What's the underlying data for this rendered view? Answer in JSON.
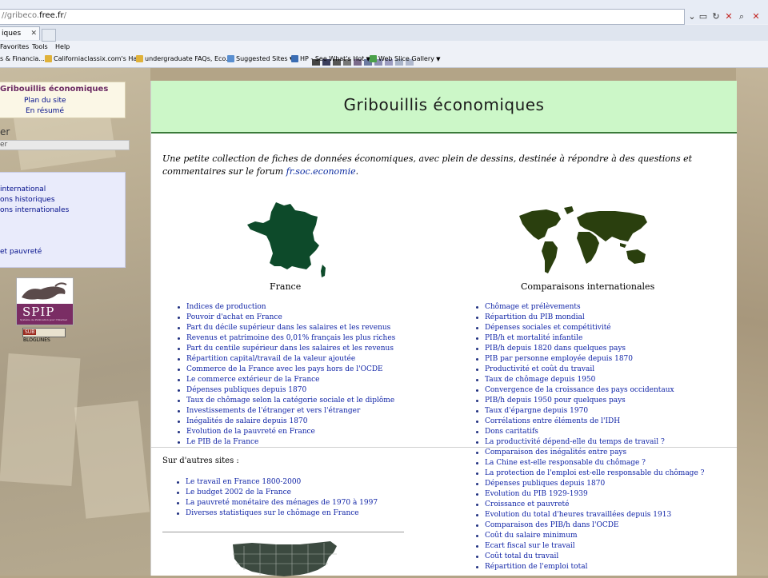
{
  "browser": {
    "url_prefix": "//gribeco.",
    "url_host": "free.fr",
    "url_suffix": "/",
    "tab_label": "iques",
    "menu": [
      "Favorites",
      "Tools",
      "Help"
    ],
    "favorites": [
      {
        "label": "s & Financia...",
        "icon_color": "#d9822b"
      },
      {
        "label": "Californiaclassix.com's Ha...",
        "icon_color": "#e0b23a"
      },
      {
        "label": "undergraduate FAQs, Eco...",
        "icon_color": "#e0b23a"
      },
      {
        "label": "Suggested Sites",
        "icon_color": "#5a8fd0",
        "dropdown": true
      },
      {
        "label": "HP - See What's Hot",
        "icon_color": "#3b6db3",
        "dropdown": true
      },
      {
        "label": "Web Slice Gallery",
        "icon_color": "#4aa04a",
        "dropdown": true
      }
    ],
    "swatch_colors": [
      "#444",
      "#3a3d5c",
      "#555",
      "#777",
      "#7a6a8a",
      "#6c7aa0",
      "#8d8fb3",
      "#9c9cc0",
      "#a9b4c9",
      "#b0b9ce"
    ]
  },
  "sidebar": {
    "site_title": "Gribouillis économiques",
    "plan_label": "Plan du site",
    "resume_label": "En résumé",
    "search_title": "er",
    "search_value": "er",
    "rubriques": [
      "international",
      "ons historiques",
      "ons internationales",
      "",
      "et pauvreté"
    ],
    "spip_word": "SPIP",
    "spip_sub": "Système de Publication pour l'Internet",
    "bloglines_a": "SUB",
    "bloglines_b": "BLOGLINES"
  },
  "main": {
    "title": "Gribouillis économiques",
    "intro_text": "Une petite collection de fiches de données économiques, avec plein de dessins, destinée à répondre à des questions et commentaires sur le forum ",
    "intro_link": "fr.soc.economie",
    "intro_end": ".",
    "france_caption": "France",
    "world_caption": "Comparaisons internationales",
    "france_links": [
      "Indices de production",
      "Pouvoir d'achat en France",
      "Part du décile supérieur dans les salaires et les revenus",
      "Revenus et patrimoine des 0,01% français les plus riches",
      "Part du centile supérieur dans les salaires et les revenus",
      "Répartition capital/travail de la valeur ajoutée",
      "Commerce de la France avec les pays hors de l'OCDE",
      "Le commerce extérieur de la France",
      "Dépenses publiques depuis 1870",
      "Taux de chômage selon la catégorie sociale et le diplôme",
      "Investissements de l'étranger et vers l'étranger",
      "Inégalités de salaire depuis 1870",
      "Evolution de la pauvreté en France",
      "Le PIB de la France"
    ],
    "world_links": [
      "Chômage et prélèvements",
      "Répartition du PIB mondial",
      "Dépenses sociales et compétitivité",
      "PIB/h et mortalité infantile",
      "PIB/h depuis 1820 dans quelques pays",
      "PIB par personne employée depuis 1870",
      "Productivité et coût du travail",
      "Taux de chômage depuis 1950",
      "Convergence de la croissance des pays occidentaux",
      "PIB/h depuis 1950 pour quelques pays",
      "Taux d'épargne depuis 1970",
      "Corrélations entre éléments de l'IDH",
      "Dons caritatifs",
      "La productivité dépend-elle du temps de travail ?",
      "Comparaison des inégalités entre pays",
      "La Chine est-elle responsable du chômage ?",
      "La protection de l'emploi est-elle responsable du chômage ?",
      "Dépenses publiques depuis 1870",
      "Evolution du PIB 1929-1939",
      "Croissance et pauvreté",
      "Evolution du total d'heures travaillées depuis 1913",
      "Comparaison des PIB/h dans l'OCDE",
      "Coût du salaire minimum",
      "Ecart fiscal sur le travail",
      "Coût total du travail",
      "Répartition de l'emploi total"
    ],
    "autres_title": "Sur d'autres sites :",
    "autres_links": [
      "Le travail en France 1800-2000",
      "Le budget 2002 de la France",
      "La pauvreté monétaire des ménages de 1970 à 1997",
      "Diverses statistiques sur le chômage en France"
    ],
    "map_color_france": "#0d4a2a",
    "map_color_world": "#2a3f0e"
  }
}
